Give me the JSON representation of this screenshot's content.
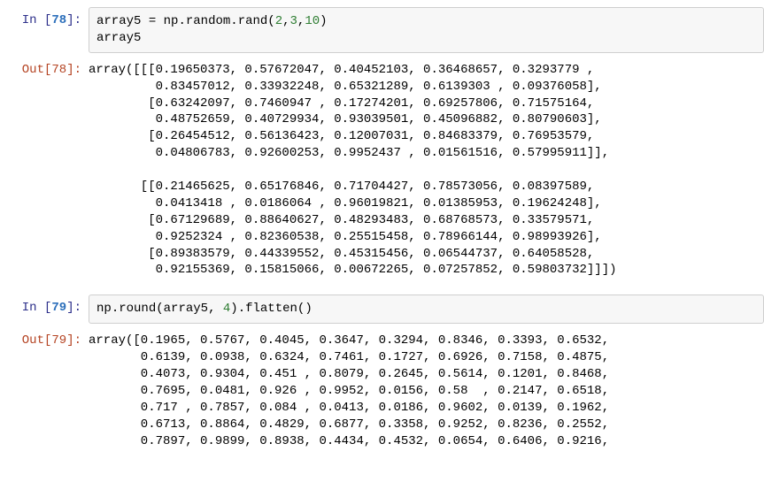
{
  "cells": {
    "c0": {
      "in_prompt_name": "In [",
      "in_prompt_num": "78",
      "in_prompt_close": "]:",
      "code_tokens": {
        "t0": "array5",
        "t1": " = ",
        "t2": "np",
        "t3": ".",
        "t4": "random",
        "t5": ".",
        "t6": "rand",
        "t7": "(",
        "t8": "2",
        "t9": ",",
        "t10": "3",
        "t11": ",",
        "t12": "10",
        "t13": ")",
        "t14": "\narray5"
      },
      "out_prompt_name": "Out[",
      "out_prompt_num": "78",
      "out_prompt_close": "]:",
      "output": "array([[[0.19650373, 0.57672047, 0.40452103, 0.36468657, 0.3293779 ,\n         0.83457012, 0.33932248, 0.65321289, 0.6139303 , 0.09376058],\n        [0.63242097, 0.7460947 , 0.17274201, 0.69257806, 0.71575164,\n         0.48752659, 0.40729934, 0.93039501, 0.45096882, 0.80790603],\n        [0.26454512, 0.56136423, 0.12007031, 0.84683379, 0.76953579,\n         0.04806783, 0.92600253, 0.9952437 , 0.01561516, 0.57995911]],\n\n       [[0.21465625, 0.65176846, 0.71704427, 0.78573056, 0.08397589,\n         0.0413418 , 0.0186064 , 0.96019821, 0.01385953, 0.19624248],\n        [0.67129689, 0.88640627, 0.48293483, 0.68768573, 0.33579571,\n         0.9252324 , 0.82360538, 0.25515458, 0.78966144, 0.98993926],\n        [0.89383579, 0.44339552, 0.45315456, 0.06544737, 0.64058528,\n         0.92155369, 0.15815066, 0.00672265, 0.07257852, 0.59803732]]])"
    },
    "c1": {
      "in_prompt_name": "In [",
      "in_prompt_num": "79",
      "in_prompt_close": "]:",
      "code_tokens": {
        "t0": "np",
        "t1": ".",
        "t2": "round",
        "t3": "(",
        "t4": "array5",
        "t5": ", ",
        "t6": "4",
        "t7": ")",
        "t8": ".",
        "t9": "flatten",
        "t10": "(",
        "t11": ")"
      },
      "out_prompt_name": "Out[",
      "out_prompt_num": "79",
      "out_prompt_close": "]:",
      "output": "array([0.1965, 0.5767, 0.4045, 0.3647, 0.3294, 0.8346, 0.3393, 0.6532,\n       0.6139, 0.0938, 0.6324, 0.7461, 0.1727, 0.6926, 0.7158, 0.4875,\n       0.4073, 0.9304, 0.451 , 0.8079, 0.2645, 0.5614, 0.1201, 0.8468,\n       0.7695, 0.0481, 0.926 , 0.9952, 0.0156, 0.58  , 0.2147, 0.6518,\n       0.717 , 0.7857, 0.084 , 0.0413, 0.0186, 0.9602, 0.0139, 0.1962,\n       0.6713, 0.8864, 0.4829, 0.6877, 0.3358, 0.9252, 0.8236, 0.2552,\n       0.7897, 0.9899, 0.8938, 0.4434, 0.4532, 0.0654, 0.6406, 0.9216,"
    }
  }
}
